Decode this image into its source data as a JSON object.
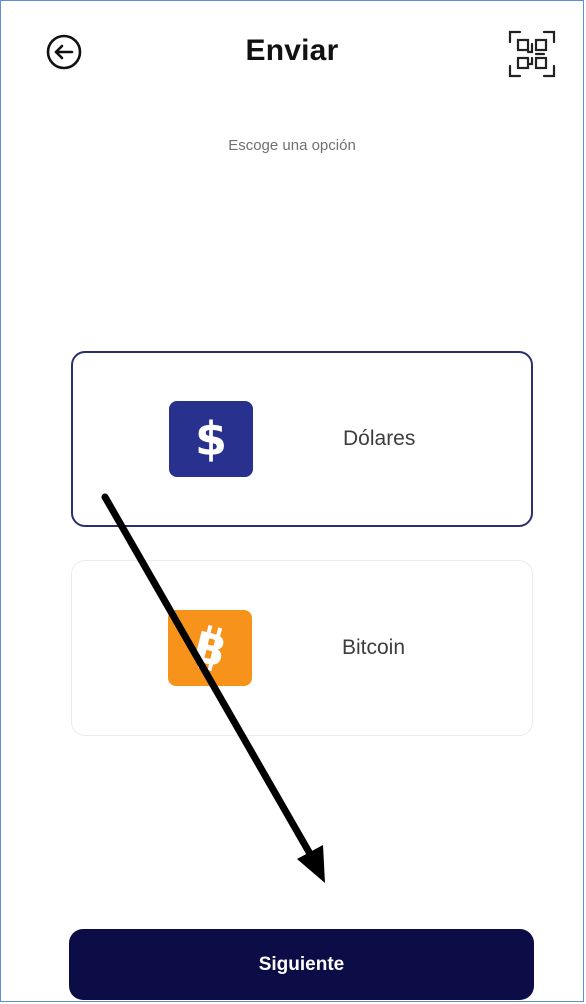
{
  "header": {
    "title": "Enviar",
    "back_icon": "arrow-left-circle-icon",
    "qr_icon": "qr-scan-icon"
  },
  "subtitle": "Escoge una opción",
  "options": [
    {
      "label": "Dólares",
      "icon": "dollar-icon",
      "symbol": "$",
      "icon_color": "#28318e",
      "selected": true
    },
    {
      "label": "Bitcoin",
      "icon": "bitcoin-icon",
      "symbol": "B",
      "icon_color": "#f7931a",
      "selected": false
    }
  ],
  "next_button": {
    "label": "Siguiente",
    "color": "#0c0c47"
  },
  "colors": {
    "selected_border": "#2b2f6e",
    "annotation_arrow": "#000000"
  }
}
